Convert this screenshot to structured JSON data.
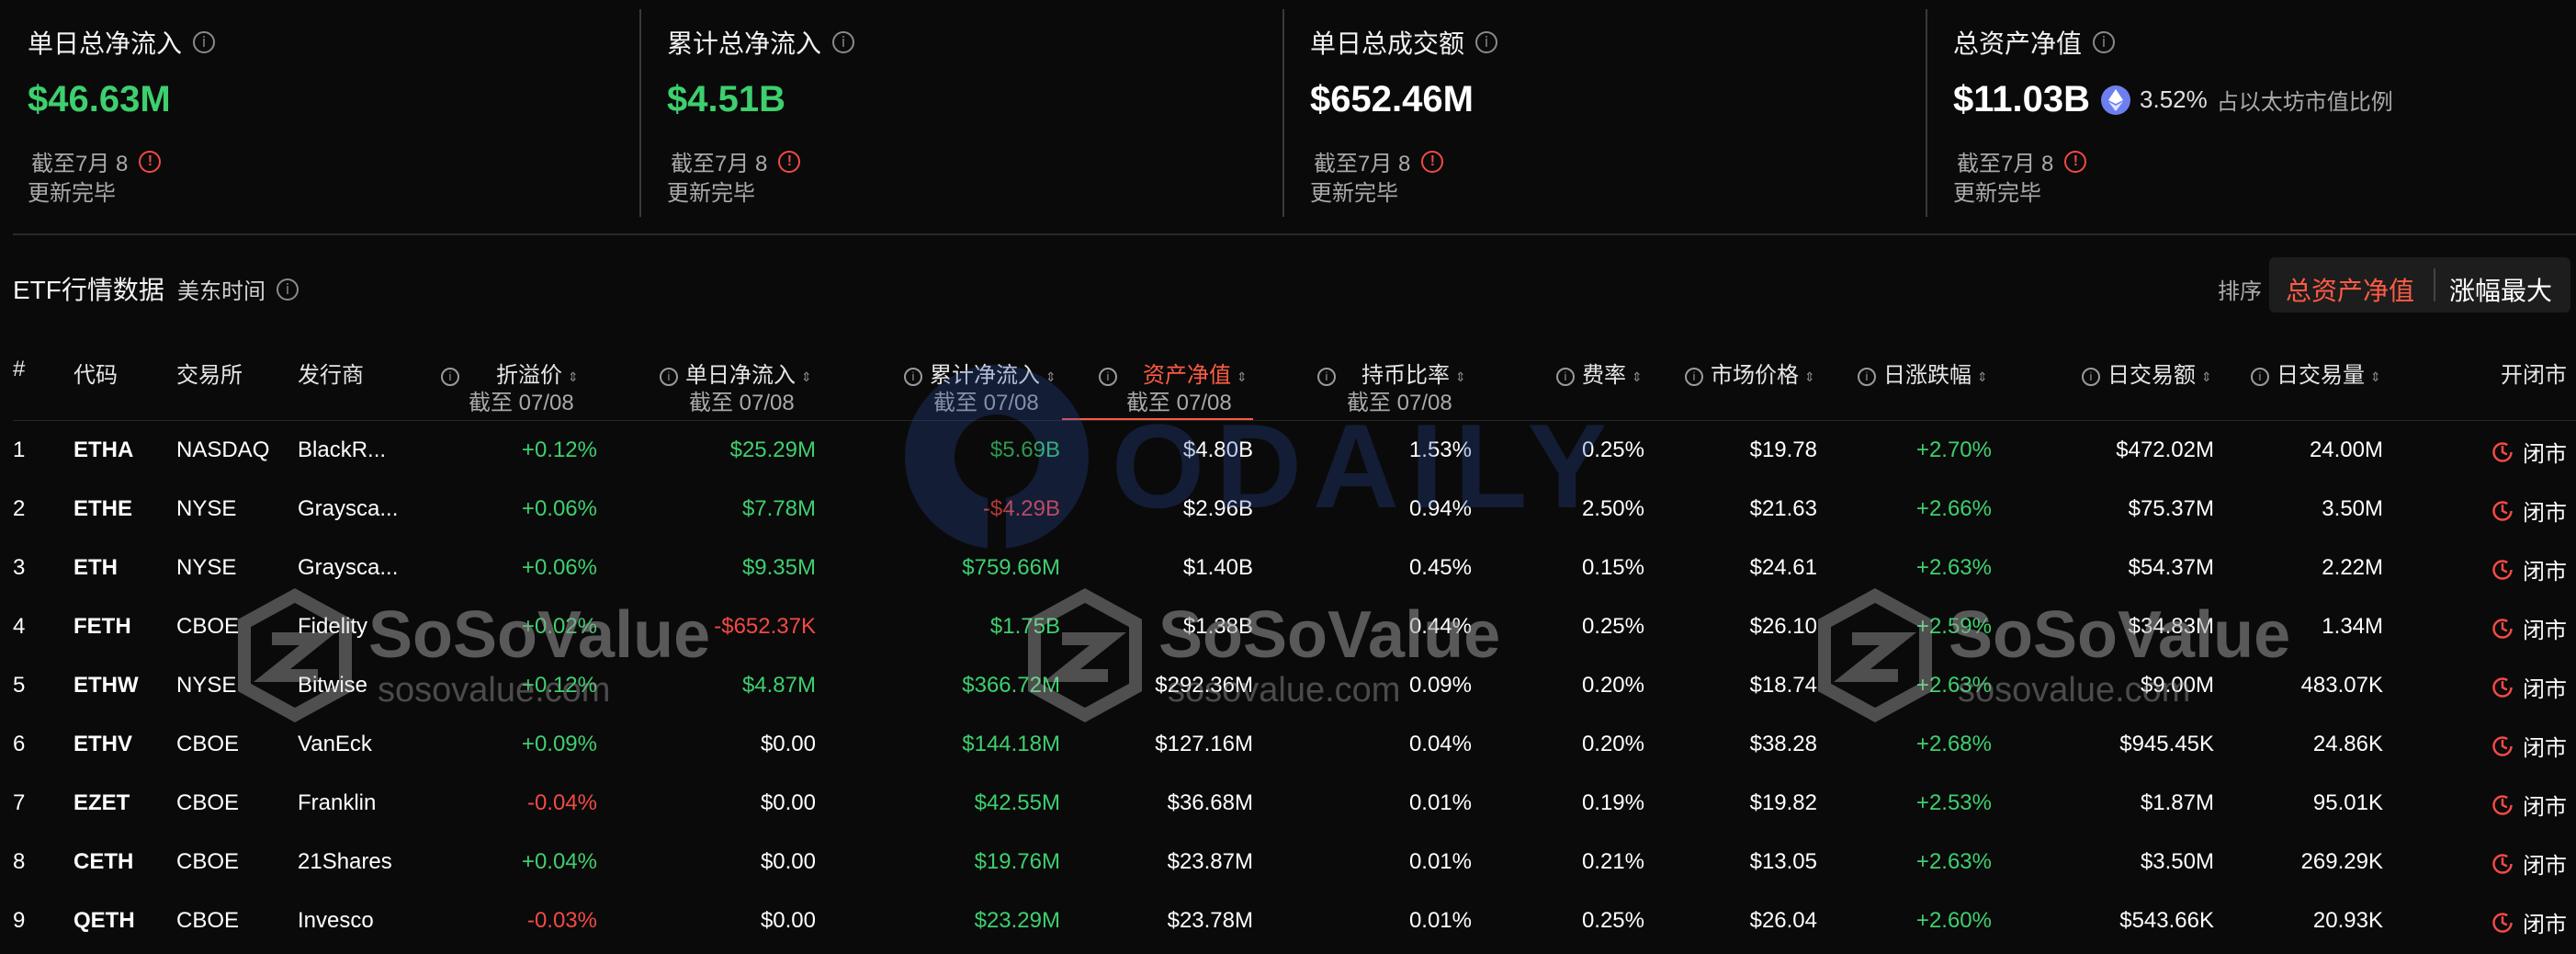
{
  "cards": [
    {
      "title": "单日总净流入",
      "value": "$46.63M",
      "date": "截至7月 8",
      "status": "更新完毕"
    },
    {
      "title": "累计总净流入",
      "value": "$4.51B",
      "date": "截至7月 8",
      "status": "更新完毕"
    },
    {
      "title": "单日总成交额",
      "value": "$652.46M",
      "date": "截至7月 8",
      "status": "更新完毕"
    },
    {
      "title": "总资产净值",
      "value": "$11.03B",
      "pct": "3.52%",
      "note": "占以太坊市值比例",
      "date": "截至7月 8",
      "status": "更新完毕"
    }
  ],
  "section": {
    "title": "ETF行情数据",
    "timezone": "美东时间",
    "sort_label": "排序",
    "sort_active": "总资产净值",
    "sort_other": "涨幅最大"
  },
  "columns": {
    "idx": "#",
    "code": "代码",
    "exchange": "交易所",
    "issuer": "发行商",
    "premium": "折溢价",
    "premium_sub": "截至 07/08",
    "daily_inflow": "单日净流入",
    "daily_inflow_sub": "截至 07/08",
    "cum_inflow": "累计净流入",
    "cum_inflow_sub": "截至 07/08",
    "nav": "资产净值",
    "nav_sub": "截至 07/08",
    "holding": "持币比率",
    "holding_sub": "截至 07/08",
    "fee": "费率",
    "price": "市场价格",
    "change": "日涨跌幅",
    "turnover": "日交易额",
    "volume": "日交易量",
    "status": "开闭市"
  },
  "rows": [
    {
      "idx": "1",
      "code": "ETHA",
      "exchange": "NASDAQ",
      "issuer": "BlackR...",
      "premium": "+0.12%",
      "daily_inflow": "$25.29M",
      "cum_inflow": "$5.69B",
      "nav": "$4.80B",
      "holding": "1.53%",
      "fee": "0.25%",
      "price": "$19.78",
      "change": "+2.70%",
      "turnover": "$472.02M",
      "volume": "24.00M",
      "status": "闭市"
    },
    {
      "idx": "2",
      "code": "ETHE",
      "exchange": "NYSE",
      "issuer": "Graysca...",
      "premium": "+0.06%",
      "daily_inflow": "$7.78M",
      "cum_inflow": "-$4.29B",
      "nav": "$2.96B",
      "holding": "0.94%",
      "fee": "2.50%",
      "price": "$21.63",
      "change": "+2.66%",
      "turnover": "$75.37M",
      "volume": "3.50M",
      "status": "闭市"
    },
    {
      "idx": "3",
      "code": "ETH",
      "exchange": "NYSE",
      "issuer": "Graysca...",
      "premium": "+0.06%",
      "daily_inflow": "$9.35M",
      "cum_inflow": "$759.66M",
      "nav": "$1.40B",
      "holding": "0.45%",
      "fee": "0.15%",
      "price": "$24.61",
      "change": "+2.63%",
      "turnover": "$54.37M",
      "volume": "2.22M",
      "status": "闭市"
    },
    {
      "idx": "4",
      "code": "FETH",
      "exchange": "CBOE",
      "issuer": "Fidelity",
      "premium": "+0.02%",
      "daily_inflow": "-$652.37K",
      "cum_inflow": "$1.75B",
      "nav": "$1.38B",
      "holding": "0.44%",
      "fee": "0.25%",
      "price": "$26.10",
      "change": "+2.59%",
      "turnover": "$34.83M",
      "volume": "1.34M",
      "status": "闭市"
    },
    {
      "idx": "5",
      "code": "ETHW",
      "exchange": "NYSE",
      "issuer": "Bitwise",
      "premium": "+0.12%",
      "daily_inflow": "$4.87M",
      "cum_inflow": "$366.72M",
      "nav": "$292.36M",
      "holding": "0.09%",
      "fee": "0.20%",
      "price": "$18.74",
      "change": "+2.63%",
      "turnover": "$9.00M",
      "volume": "483.07K",
      "status": "闭市"
    },
    {
      "idx": "6",
      "code": "ETHV",
      "exchange": "CBOE",
      "issuer": "VanEck",
      "premium": "+0.09%",
      "daily_inflow": "$0.00",
      "cum_inflow": "$144.18M",
      "nav": "$127.16M",
      "holding": "0.04%",
      "fee": "0.20%",
      "price": "$38.28",
      "change": "+2.68%",
      "turnover": "$945.45K",
      "volume": "24.86K",
      "status": "闭市"
    },
    {
      "idx": "7",
      "code": "EZET",
      "exchange": "CBOE",
      "issuer": "Franklin",
      "premium": "-0.04%",
      "daily_inflow": "$0.00",
      "cum_inflow": "$42.55M",
      "nav": "$36.68M",
      "holding": "0.01%",
      "fee": "0.19%",
      "price": "$19.82",
      "change": "+2.53%",
      "turnover": "$1.87M",
      "volume": "95.01K",
      "status": "闭市"
    },
    {
      "idx": "8",
      "code": "CETH",
      "exchange": "CBOE",
      "issuer": "21Shares",
      "premium": "+0.04%",
      "daily_inflow": "$0.00",
      "cum_inflow": "$19.76M",
      "nav": "$23.87M",
      "holding": "0.01%",
      "fee": "0.21%",
      "price": "$13.05",
      "change": "+2.63%",
      "turnover": "$3.50M",
      "volume": "269.29K",
      "status": "闭市"
    },
    {
      "idx": "9",
      "code": "QETH",
      "exchange": "CBOE",
      "issuer": "Invesco",
      "premium": "-0.03%",
      "daily_inflow": "$0.00",
      "cum_inflow": "$23.29M",
      "nav": "$23.78M",
      "holding": "0.01%",
      "fee": "0.25%",
      "price": "$26.04",
      "change": "+2.60%",
      "turnover": "$543.66K",
      "volume": "20.93K",
      "status": "闭市"
    }
  ],
  "watermarks": {
    "brand": "SoSoValue",
    "domain": "sosovalue.com",
    "odaily": "ODAILY"
  },
  "colors": {
    "positive": "#3ecf6e",
    "negative": "#f24a45",
    "accent": "#ff5b45",
    "zero": "#ffffff"
  },
  "icons": {
    "info": "info-icon",
    "warning": "warning-icon",
    "eth": "ethereum-icon",
    "clock": "clock-icon",
    "sort": "sort-arrows-icon"
  }
}
